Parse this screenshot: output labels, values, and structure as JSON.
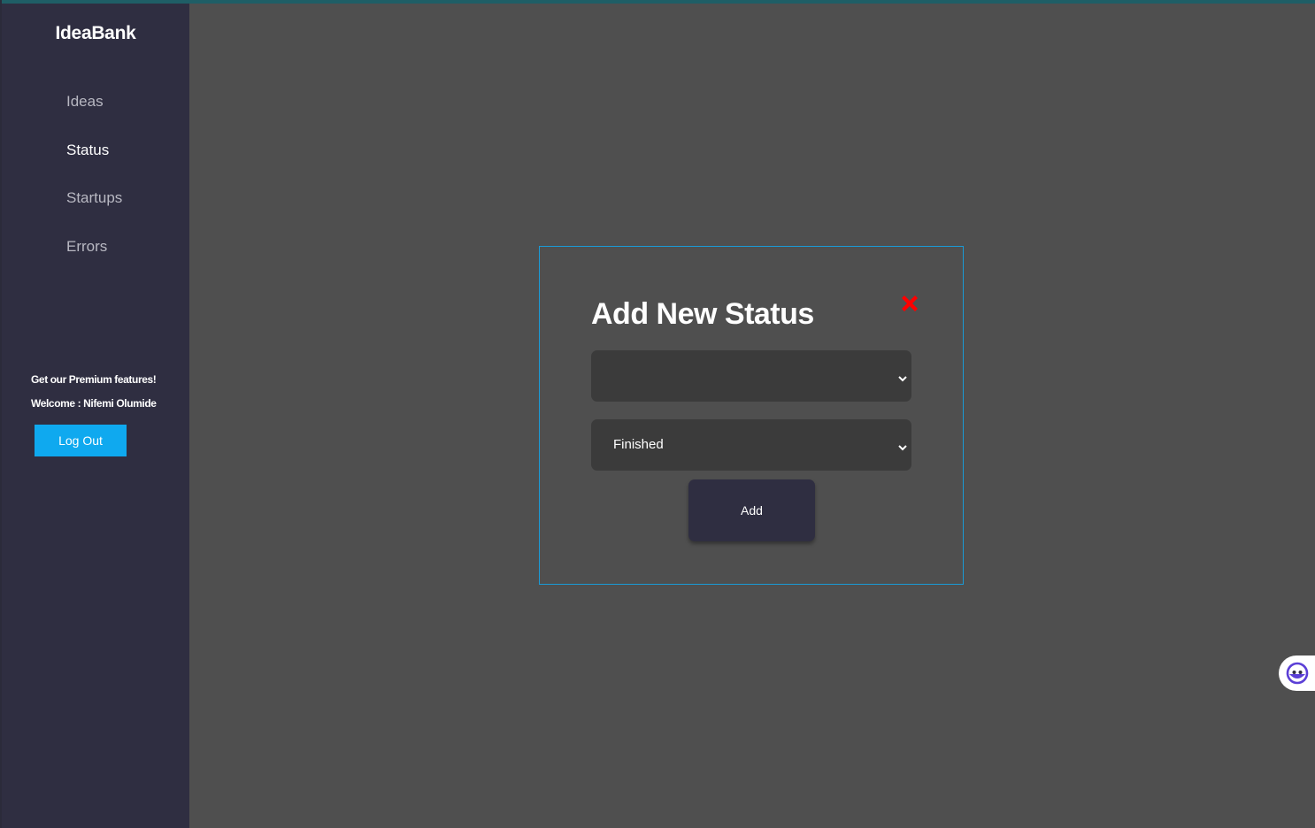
{
  "app": {
    "brand": "IdeaBank"
  },
  "sidebar": {
    "items": [
      {
        "label": "Ideas",
        "active": false
      },
      {
        "label": "Status",
        "active": true
      },
      {
        "label": "Startups",
        "active": false
      },
      {
        "label": "Errors",
        "active": false
      }
    ],
    "premium_text": "Get our Premium features!",
    "welcome_text": "Welcome : Nifemi Olumide",
    "logout_label": "Log Out"
  },
  "modal": {
    "title": "Add New Status",
    "close_icon": "close-x-icon",
    "select_primary": {
      "value": ""
    },
    "select_status": {
      "value": "Finished"
    },
    "add_label": "Add"
  },
  "colors": {
    "sidebar_bg": "#2f2e41",
    "main_bg": "#4f4f4f",
    "modal_border": "#1a9ad6",
    "logout_bg": "#0fa9ef",
    "close_icon": "#ff0000",
    "select_bg": "#3b3b3b",
    "chat_accent": "#5b3fd6"
  },
  "chat_widget": {
    "icon": "chat-bot-icon"
  }
}
